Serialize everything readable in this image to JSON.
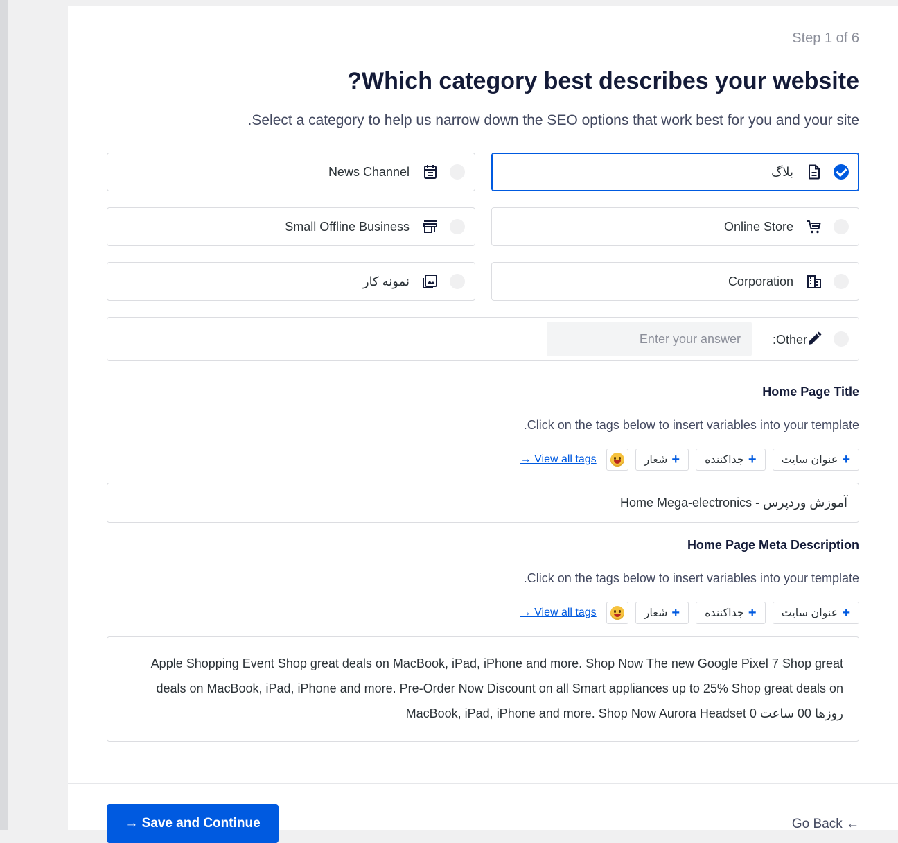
{
  "step": "Step 1 of 6",
  "title": "?Which category best describes your website",
  "subtitle": ".Select a category to help us narrow down the SEO options that work best for you and your site",
  "options": [
    {
      "label": "بلاگ",
      "icon": "document-icon",
      "selected": true
    },
    {
      "label": "News Channel",
      "icon": "news-icon",
      "selected": false
    },
    {
      "label": "Online Store",
      "icon": "cart-icon",
      "selected": false
    },
    {
      "label": "Small Offline Business",
      "icon": "store-icon",
      "selected": false
    },
    {
      "label": "Corporation",
      "icon": "building-icon",
      "selected": false
    },
    {
      "label": "نمونه کار",
      "icon": "image-icon",
      "selected": false
    }
  ],
  "other": {
    "label": ":Other",
    "placeholder": "Enter your answer",
    "icon": "pencil-icon"
  },
  "home_title": {
    "label": "Home Page Title",
    "help": ".Click on the tags below to insert variables into your template",
    "tags": [
      "عنوان سایت",
      "جداکننده",
      "شعار"
    ],
    "view_all": "→ View all tags",
    "value": "Home Mega-electronics - آموزش وردپرس"
  },
  "home_meta": {
    "label": "Home Page Meta Description",
    "help": ".Click on the tags below to insert variables into your template",
    "tags": [
      "عنوان سایت",
      "جداکننده",
      "شعار"
    ],
    "view_all": "→ View all tags",
    "value": "Apple Shopping Event Shop great deals on MacBook, iPad, iPhone and more. Shop Now The new Google Pixel 7 Shop great deals on MacBook, iPad, iPhone and more. Pre-Order Now Discount on all Smart appliances up to 25% Shop great deals on MacBook, iPad, iPhone and more. Shop Now Aurora Headset 0 روزها 00 ساعت"
  },
  "footer": {
    "save_label": "→ Save and Continue",
    "back_label": "Go Back  ←"
  },
  "colors": {
    "accent": "#005ae0",
    "border": "#dcdde1",
    "text": "#141b38"
  }
}
